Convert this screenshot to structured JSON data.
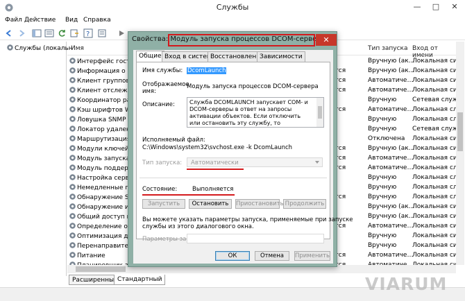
{
  "window": {
    "title": "Службы"
  },
  "menu": [
    "Файл",
    "Действие",
    "Вид",
    "Справка"
  ],
  "tree": {
    "root": "Службы (локальн"
  },
  "list": {
    "columns": {
      "name": "Имя",
      "startup_type": "Тип запуска",
      "logon": "Вход от имени"
    },
    "rows": [
      {
        "name": "Интерфейс гостев",
        "status": "",
        "startup": "Вручную (ак…",
        "logon": "Локальная си"
      },
      {
        "name": "Информация о сов",
        "status": "ется",
        "startup": "Вручную (ак…",
        "logon": "Локальная си"
      },
      {
        "name": "Клиент группово",
        "status": "ется",
        "startup": "Автоматиче…",
        "logon": "Локальная си"
      },
      {
        "name": "Клиент отслежива",
        "status": "ется",
        "startup": "Автоматиче…",
        "logon": "Локальная си"
      },
      {
        "name": "Координатор рас",
        "status": "",
        "startup": "Вручную",
        "logon": "Сетевая служ"
      },
      {
        "name": "Кэш шрифтов Wi",
        "status": "ется",
        "startup": "Автоматиче…",
        "logon": "Локальная сл"
      },
      {
        "name": "Ловушка SNMP",
        "status": "",
        "startup": "Вручную",
        "logon": "Локальная сл"
      },
      {
        "name": "Локатор удален",
        "status": "",
        "startup": "Вручную",
        "logon": "Сетевая служ"
      },
      {
        "name": "Маршрутизация",
        "status": "",
        "startup": "Отключена",
        "logon": "Локальная си"
      },
      {
        "name": "Модули ключей I",
        "status": "ется",
        "startup": "Вручную (ак…",
        "logon": "Локальная си"
      },
      {
        "name": "Модуль запуска п",
        "status": "ется",
        "startup": "Автоматиче…",
        "logon": "Локальная си"
      },
      {
        "name": "Модуль поддерж",
        "status": "ется",
        "startup": "Автоматиче…",
        "logon": "Локальная сл"
      },
      {
        "name": "Настройка сервер",
        "status": "",
        "startup": "Вручную",
        "logon": "Локальная сл"
      },
      {
        "name": "Немедленные по",
        "status": "",
        "startup": "Вручную",
        "logon": "Локальная сл"
      },
      {
        "name": "Обнаружение SSD",
        "status": "ется",
        "startup": "Вручную",
        "logon": "Локальная сл"
      },
      {
        "name": "Обнаружение инт",
        "status": "",
        "startup": "Вручную (ак…",
        "logon": "Локальная си"
      },
      {
        "name": "Общий доступ к",
        "status": "",
        "startup": "Вручную (ак…",
        "logon": "Локальная си"
      },
      {
        "name": "Определение обо",
        "status": "ется",
        "startup": "Автоматиче…",
        "logon": "Локальная си"
      },
      {
        "name": "Оптимизация дис",
        "status": "",
        "startup": "Вручную",
        "logon": "Локальная си"
      },
      {
        "name": "Перенаправитель",
        "status": "",
        "startup": "Вручную",
        "logon": "Локальная си"
      },
      {
        "name": "Питание",
        "status": "ется",
        "startup": "Автоматиче…",
        "logon": "Локальная си"
      },
      {
        "name": "Планировщик зад",
        "status": "ется",
        "startup": "Автоматиче…",
        "logon": "Локальная си"
      }
    ]
  },
  "bottom_tabs": [
    "Расширенный",
    "Стандартный"
  ],
  "watermark": "VIARUM",
  "dialog": {
    "title": "Свойства: Модуль запуска процессов DCOM-серве…",
    "close": "✕",
    "tabs": [
      "Общие",
      "Вход в систему",
      "Восстановление",
      "Зависимости"
    ],
    "service_name_label": "Имя службы:",
    "service_name": "DcomLaunch",
    "display_name_label_1": "Отображаемое",
    "display_name_label_2": "имя:",
    "display_name": "Модуль запуска процессов DCOM-сервера",
    "description_label": "Описание:",
    "description": "Служба DCOMLAUNCH запускает COM- и DCOM-серверы в ответ на запросы активации объектов. Если отключить или остановить эту службу, то программы, использующие COM или",
    "exe_label": "Исполняемый файл:",
    "exe_path": "C:\\Windows\\system32\\svchost.exe -k DcomLaunch",
    "startup_type_label": "Тип запуска:",
    "startup_type": "Автоматически",
    "status_label": "Состояние:",
    "status": "Выполняется",
    "buttons": {
      "start": "Запустить",
      "stop": "Остановить",
      "pause": "Приостановить",
      "resume": "Продолжить"
    },
    "hint_1": "Вы можете указать параметры запуска, применяемые при запуске",
    "hint_2": "службы из этого диалогового окна.",
    "params_label": "Параметры запуска:",
    "ok": "ОК",
    "cancel": "Отмена",
    "apply": "Применить"
  }
}
